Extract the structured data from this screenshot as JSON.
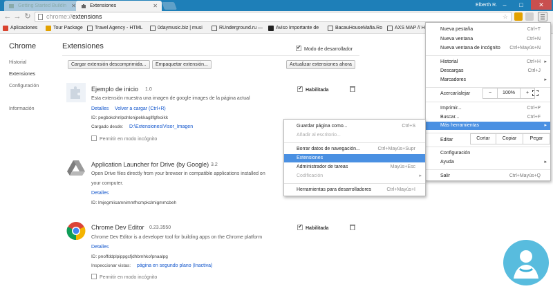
{
  "tabs": [
    {
      "label": "Getting Started Buildin",
      "active": false
    },
    {
      "label": "Extensiones",
      "active": true
    }
  ],
  "window": {
    "user": "Elberth R.",
    "minimize": "–",
    "maximize": "□",
    "close": "✕"
  },
  "toolbar": {
    "back": "←",
    "forward": "→",
    "reload": "↻",
    "url_host": "chrome://",
    "url_path": "extensions",
    "star": "☆"
  },
  "bookmarks": [
    {
      "label": "Aplicaciones",
      "color": "#d9432f"
    },
    {
      "label": "Tour Package",
      "color": "#e2a100"
    },
    {
      "label": "Travel Agency - HTML",
      "color": "#555"
    },
    {
      "label": "0daymusic.biz | musi",
      "color": "#555"
    },
    {
      "label": "RUnderground.ru —",
      "color": "#555"
    },
    {
      "label": "Aviso Importante de",
      "color": "#222"
    },
    {
      "label": "BacauHouseMafia.Ro",
      "color": "#555"
    },
    {
      "label": "AXS MAP // H",
      "color": "#555"
    }
  ],
  "sidebar": {
    "title": "Chrome",
    "items": [
      {
        "label": "Historial"
      },
      {
        "label": "Extensiones"
      },
      {
        "label": "Configuración"
      },
      {
        "label": "Información"
      }
    ]
  },
  "main": {
    "title": "Extensiones",
    "dev_mode": "Modo de desarrollador",
    "buttons": {
      "load": "Cargar extensión descomprimida...",
      "pack": "Empaquetar extensión...",
      "update": "Actualizar extensiones ahora"
    }
  },
  "extensions": [
    {
      "name": "Ejemplo de inicio",
      "version": "1.0",
      "description": "Esta extensión muestra una imagen de google images de la página actual",
      "details": "Detalles",
      "reload": "Volver a cargar (Ctrl+R)",
      "id": "ID: pegbokohnlpdnlonjpekkagllfgfeoikk",
      "loaded_from_label": "Cargado desde:",
      "loaded_from_path": "D:\\Extensiones\\Visor_Imagen",
      "incognito": "Permitir en modo incógnito",
      "enabled": "Habilitada"
    },
    {
      "name": "Application Launcher for Drive (by Google)",
      "version": "3.2",
      "description": "Open Drive files directly from your browser in compatible applications installed on",
      "description2": "your computer.",
      "details": "Detalles",
      "id": "ID: lmjegmlicamnimmfhcmpkclmigmmcbeh"
    },
    {
      "name": "Chrome Dev Editor",
      "version": "0.23.3550",
      "description": "Chrome Dev Editor is a developer tool for building apps on the Chrome platform",
      "details": "Detalles",
      "id": "ID: pnoffddplpippgcfjdhbmhkofpnaalpg",
      "inspect_label": "Inspeccionar vistas:",
      "inspect_link": "página en segundo plano (Inactiva)",
      "incognito": "Permitir en modo incógnito",
      "enabled": "Habilitada"
    }
  ],
  "chrome_menu": {
    "items": [
      {
        "label": "Nueva pestaña",
        "shortcut": "Ctrl+T"
      },
      {
        "label": "Nueva ventana",
        "shortcut": "Ctrl+N"
      },
      {
        "label": "Nueva ventana de incógnito",
        "shortcut": "Ctrl+Mayús+N"
      },
      {
        "label": "Historial",
        "shortcut": "Ctrl+H"
      },
      {
        "label": "Descargas",
        "shortcut": "Ctrl+J"
      },
      {
        "label": "Marcadores",
        "shortcut": ""
      },
      {
        "label": "Imprimir...",
        "shortcut": "Ctrl+P"
      },
      {
        "label": "Buscar...",
        "shortcut": "Ctrl+F"
      },
      {
        "label": "Más herramientas",
        "shortcut": ""
      },
      {
        "label": "Configuración",
        "shortcut": ""
      },
      {
        "label": "Ayuda",
        "shortcut": ""
      },
      {
        "label": "Salir",
        "shortcut": "Ctrl+Mayús+Q"
      }
    ],
    "zoom_label": "Acercar/alejar",
    "zoom_minus": "−",
    "zoom_value": "100%",
    "zoom_plus": "+",
    "edit_label": "Editar",
    "cut": "Cortar",
    "copy": "Copiar",
    "paste": "Pegar"
  },
  "more_tools_menu": {
    "items": [
      {
        "label": "Guardar página como...",
        "shortcut": "Ctrl+S"
      },
      {
        "label": "Añadir al escritorio...",
        "shortcut": ""
      },
      {
        "label": "Borrar datos de navegación...",
        "shortcut": "Ctrl+Mayús+Supr"
      },
      {
        "label": "Extensiones",
        "shortcut": ""
      },
      {
        "label": "Administrador de tareas",
        "shortcut": "Mayús+Esc"
      },
      {
        "label": "Codificación",
        "shortcut": ""
      },
      {
        "label": "Herramientas para desarrolladores",
        "shortcut": "Ctrl+Mayús+I"
      }
    ]
  },
  "colors": {
    "tabstrip": "#1e7fb8",
    "highlight": "#4a90e2",
    "link": "#1155cc"
  }
}
